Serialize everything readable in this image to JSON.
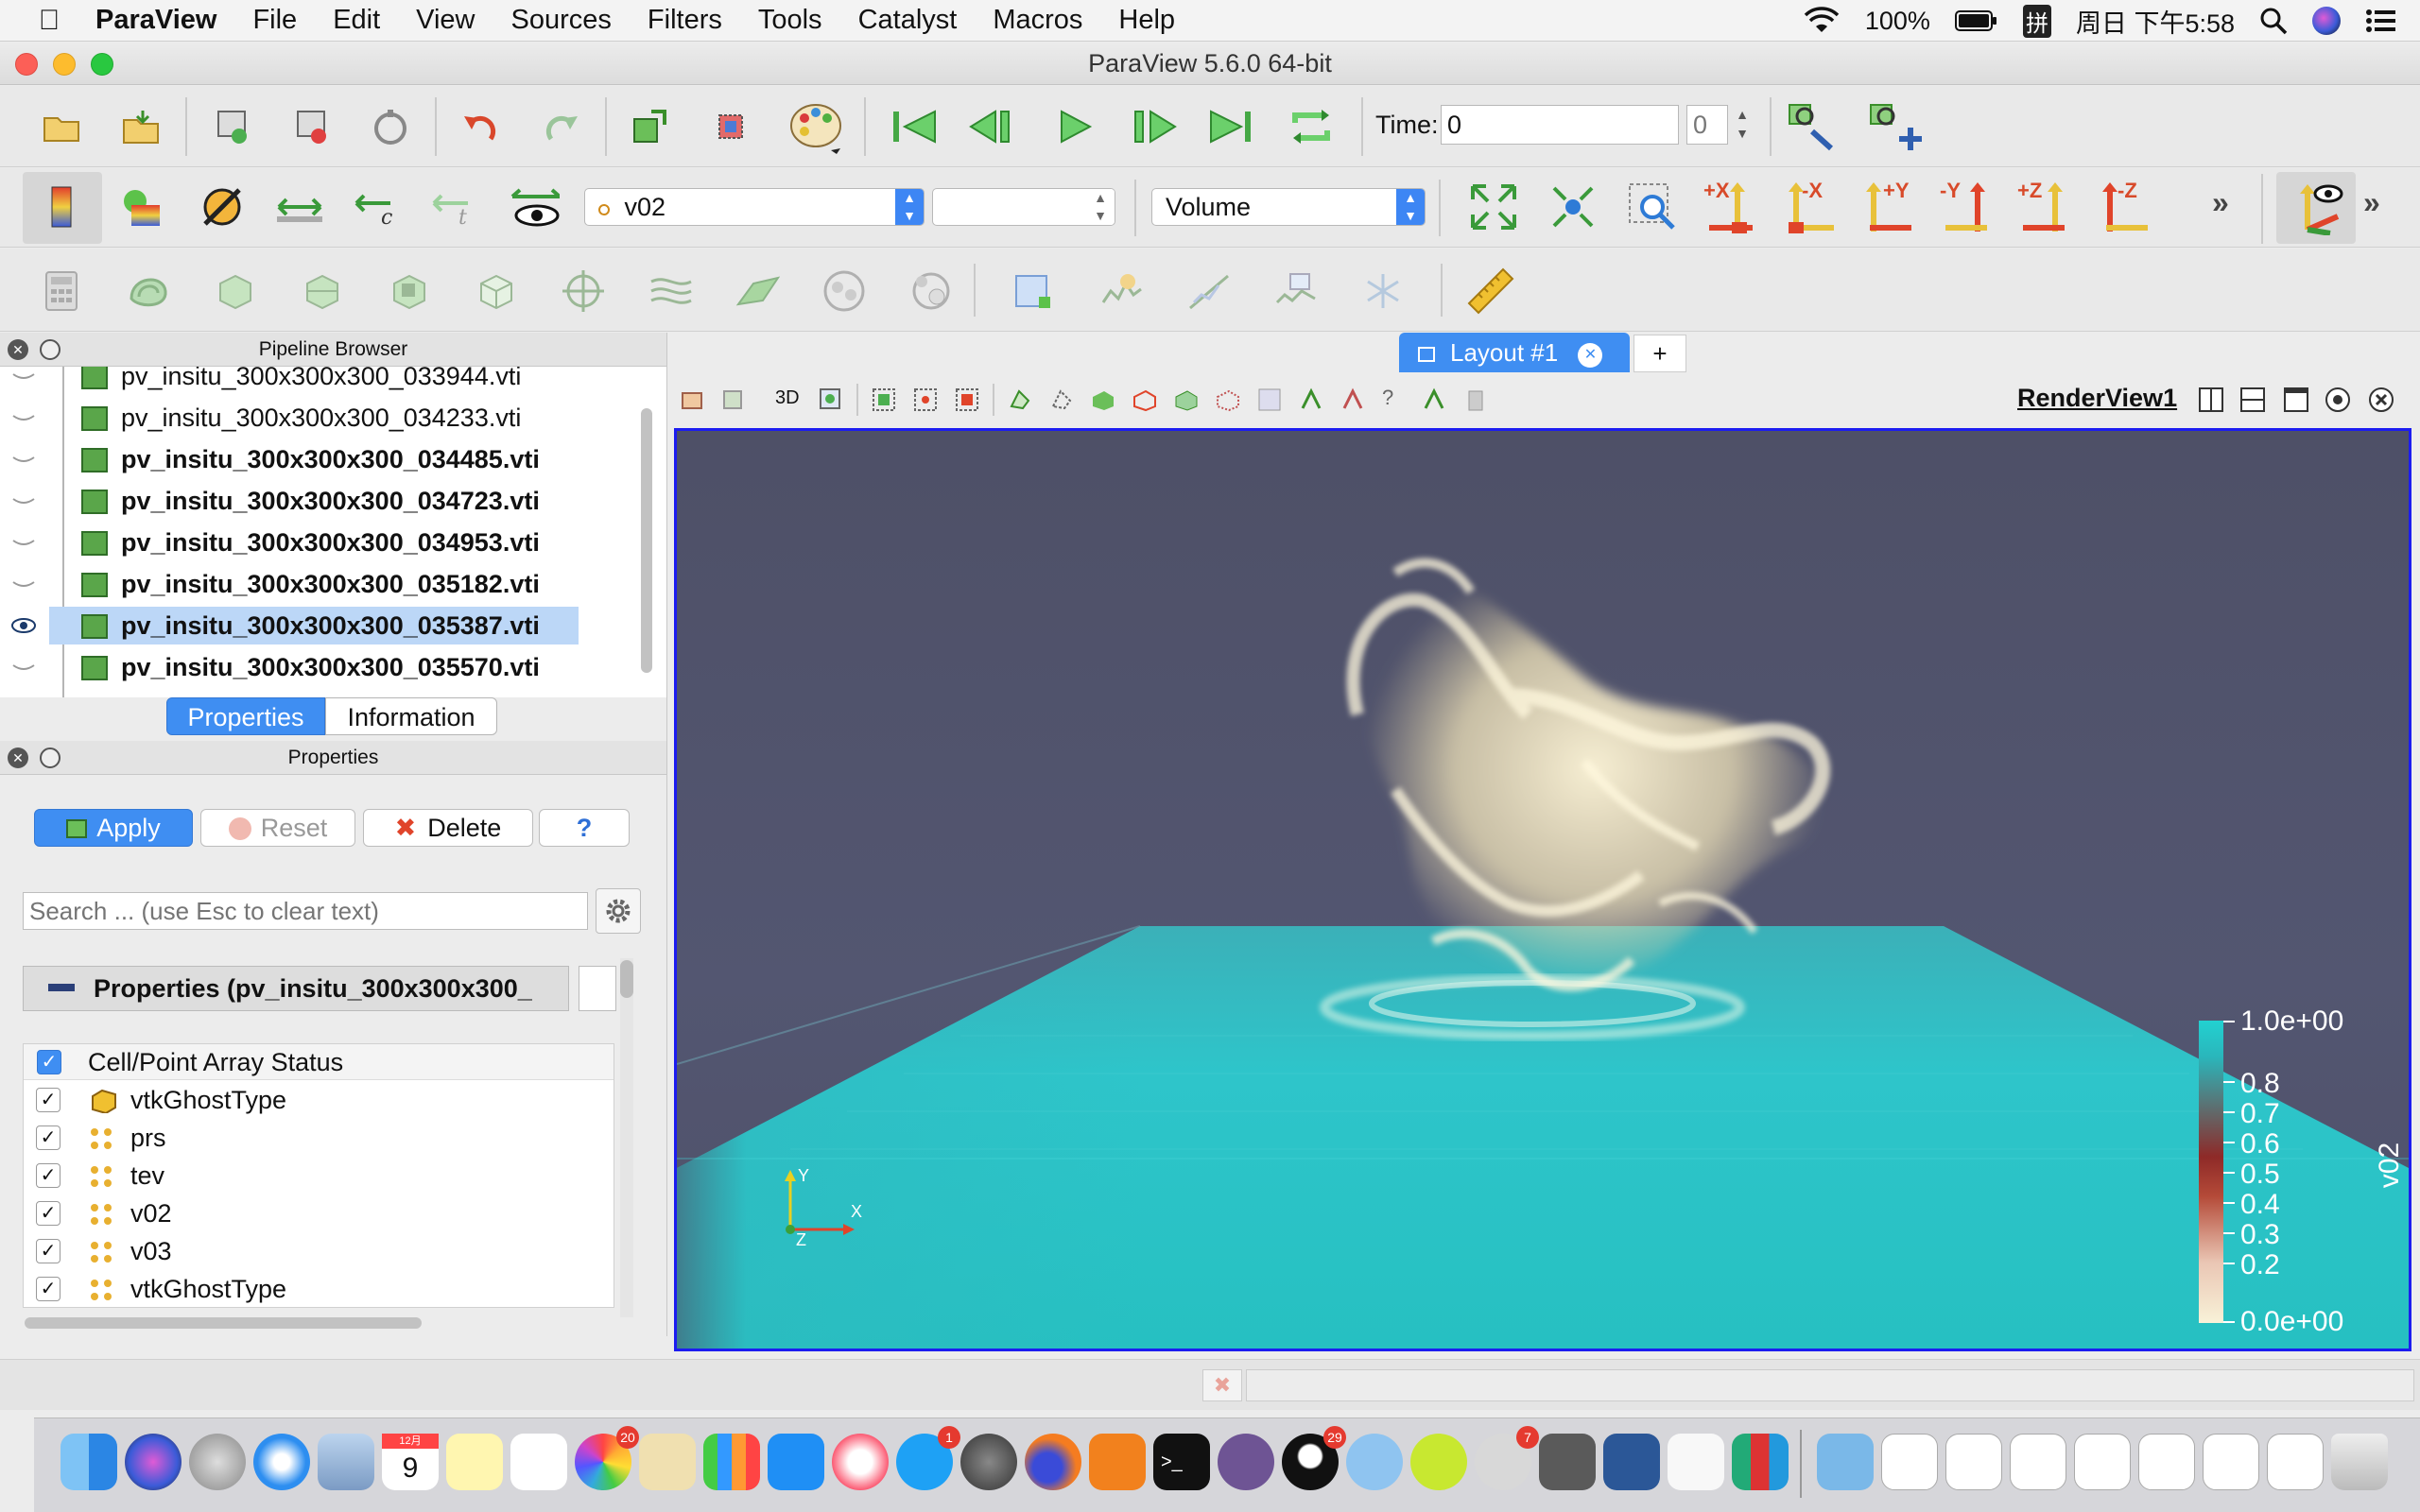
{
  "menubar": {
    "app_name": "ParaView",
    "items": [
      "File",
      "Edit",
      "View",
      "Sources",
      "Filters",
      "Tools",
      "Catalyst",
      "Macros",
      "Help"
    ],
    "battery": "100%",
    "input_method": "拼",
    "clock": "周日 下午5:58"
  },
  "window": {
    "title": "ParaView 5.6.0 64-bit"
  },
  "toolbar": {
    "time_label": "Time:",
    "time_value": "0",
    "time_step": "0",
    "active_array": "v02",
    "component": "",
    "representation": "Volume",
    "camera_labels": [
      "+X",
      "-X",
      "+Y",
      "-Y",
      "+Z",
      "-Z"
    ]
  },
  "pipeline_browser": {
    "title": "Pipeline Browser",
    "items": [
      {
        "name": "pv_insitu_300x300x300_033944.vti",
        "bold": false,
        "visible": false,
        "selected": false
      },
      {
        "name": "pv_insitu_300x300x300_034233.vti",
        "bold": false,
        "visible": false,
        "selected": false
      },
      {
        "name": "pv_insitu_300x300x300_034485.vti",
        "bold": true,
        "visible": false,
        "selected": false
      },
      {
        "name": "pv_insitu_300x300x300_034723.vti",
        "bold": true,
        "visible": false,
        "selected": false
      },
      {
        "name": "pv_insitu_300x300x300_034953.vti",
        "bold": true,
        "visible": false,
        "selected": false
      },
      {
        "name": "pv_insitu_300x300x300_035182.vti",
        "bold": true,
        "visible": false,
        "selected": false
      },
      {
        "name": "pv_insitu_300x300x300_035387.vti",
        "bold": true,
        "visible": true,
        "selected": true
      },
      {
        "name": "pv_insitu_300x300x300_035570.vti",
        "bold": true,
        "visible": false,
        "selected": false
      }
    ]
  },
  "tabs": {
    "properties": "Properties",
    "information": "Information"
  },
  "properties_panel": {
    "title": "Properties",
    "apply": "Apply",
    "reset": "Reset",
    "delete": "Delete",
    "help": "?",
    "search_placeholder": "Search ... (use Esc to clear text)",
    "section_title": "Properties (pv_insitu_300x300x300_",
    "array_header": "Cell/Point Array Status",
    "arrays": [
      {
        "name": "vtkGhostType",
        "kind": "cell"
      },
      {
        "name": "prs",
        "kind": "point"
      },
      {
        "name": "tev",
        "kind": "point"
      },
      {
        "name": "v02",
        "kind": "point"
      },
      {
        "name": "v03",
        "kind": "point"
      },
      {
        "name": "vtkGhostType",
        "kind": "point"
      }
    ]
  },
  "layout": {
    "tab_label": "Layout #1",
    "add_tab": "+",
    "view_name": "RenderView1",
    "mode_3d": "3D"
  },
  "colorbar": {
    "title": "v02",
    "labels": [
      "1.0e+00",
      "0.8",
      "0.7",
      "0.6",
      "0.5",
      "0.4",
      "0.3",
      "0.2",
      "0.0e+00"
    ]
  },
  "axes": {
    "x": "X",
    "y": "Y",
    "z": "Z"
  },
  "dock": {
    "badges": {
      "photos": "20",
      "appstore": "1",
      "qq": "29",
      "wechat": "7"
    },
    "calendar_month": "12月",
    "calendar_day": "9"
  },
  "colors": {
    "accent": "#3f8ef2",
    "render_bg": "#52546d",
    "plume": "#efe6c4",
    "plane": "#2cc7c9",
    "view_border": "#1c1cf0"
  }
}
